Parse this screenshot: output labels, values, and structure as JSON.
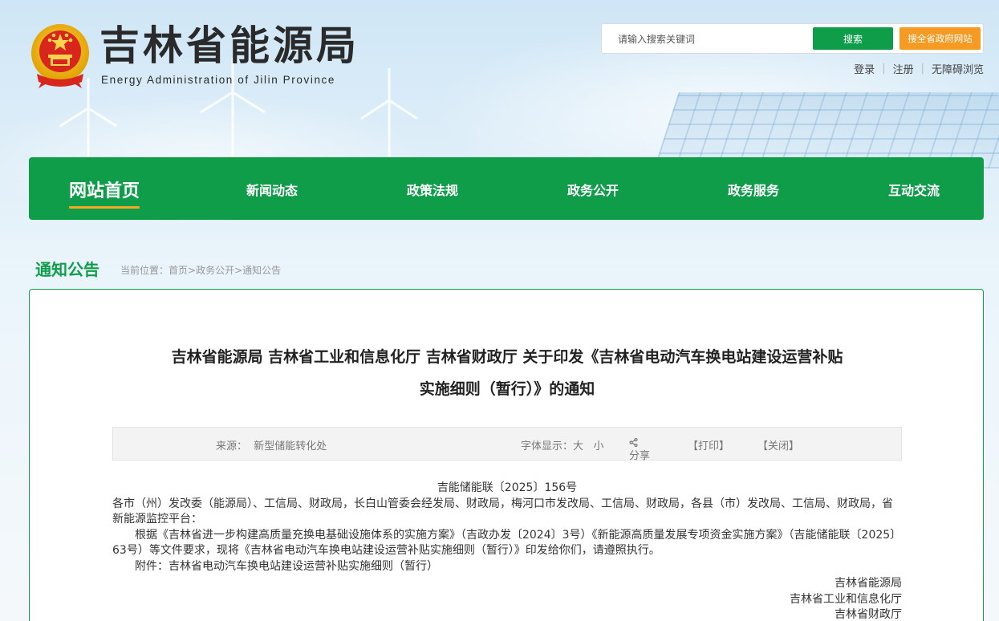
{
  "header": {
    "logo_cn": "吉林省能源局",
    "logo_en": "Energy Administration of Jilin Province"
  },
  "search": {
    "placeholder": "请输入搜索关键词",
    "button_label": "搜索",
    "whole_site_label": "搜全省政府网站"
  },
  "top_links": [
    "登录",
    "注册",
    "无障碍浏览"
  ],
  "nav": {
    "items": [
      "网站首页",
      "新闻动态",
      "政策法规",
      "政务公开",
      "政务服务",
      "互动交流"
    ]
  },
  "section": {
    "title": "通知公告",
    "breadcrumb_prefix": "当前位置：",
    "breadcrumb": [
      "首页",
      "政务公开",
      "通知公告"
    ],
    "breadcrumb_sep": ">"
  },
  "article": {
    "title_line1": "吉林省能源局 吉林省工业和信息化厅 吉林省财政厅 关于印发《吉林省电动汽车换电站建设运营补贴",
    "title_line2": "实施细则（暂行）》的通知",
    "source_label": "来源：",
    "source_value": "新型储能转化处",
    "font_label": "字体显示：",
    "font_large": "大",
    "font_small": "小",
    "share_label": "分享",
    "print_label": "【打印】",
    "close_label": "【关闭】",
    "doc_number": "吉能储能联〔2025〕156号",
    "recipients": "各市（州）发改委（能源局）、工信局、财政局，长白山管委会经发局、财政局，梅河口市发改局、工信局、财政局，各县（市）发改局、工信局、财政局，省新能源监控平台：",
    "paragraph1": "根据《吉林省进一步构建高质量充换电基础设施体系的实施方案》（吉政办发〔2024〕3号）《新能源高质量发展专项资金实施方案》（吉能储能联〔2025〕63号）等文件要求，现将《吉林省电动汽车换电站建设运营补贴实施细则（暂行）》印发给你们，请遵照执行。",
    "attachment": "附件：吉林省电动汽车换电站建设运营补贴实施细则（暂行）",
    "signatures": [
      "吉林省能源局",
      "吉林省工业和信息化厅",
      "吉林省财政厅"
    ]
  },
  "colors": {
    "brand_green": "#0f9d4a",
    "accent_orange": "#f59a23",
    "nav_underline": "#f5a623"
  }
}
